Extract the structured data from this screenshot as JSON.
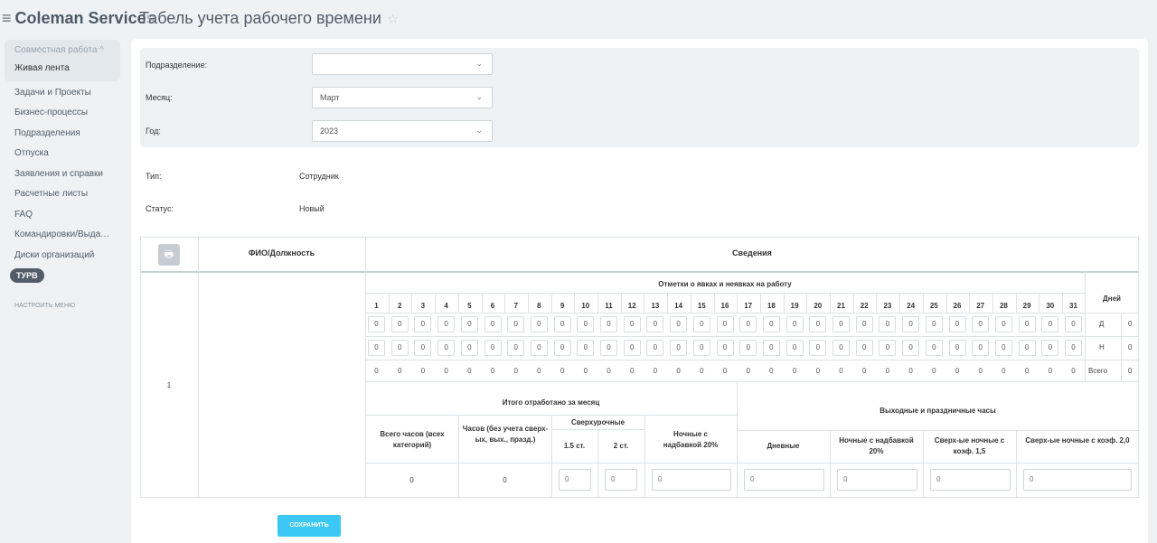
{
  "app": {
    "title_main": "Coleman Service",
    "title_cut": "s",
    "menu_glyph": "≡"
  },
  "page": {
    "title": "Табель учета рабочего времени",
    "star": "☆"
  },
  "sidebar": {
    "group_title": "Совместная работа ^",
    "items": [
      {
        "label": "Живая лента"
      },
      {
        "label": "Задачи и Проекты"
      },
      {
        "label": "Бизнес-процессы"
      },
      {
        "label": "Подразделения"
      },
      {
        "label": "Отпуска"
      },
      {
        "label": "Заявления и справки"
      },
      {
        "label": "Расчетные листы"
      },
      {
        "label": "FAQ"
      },
      {
        "label": "Командировки/Выдача п..."
      },
      {
        "label": "Диски организаций"
      }
    ],
    "badge": "ТУРВ",
    "configure": "НАСТРОИТЬ МЕНЮ"
  },
  "filters": {
    "department": {
      "label": "Подразделение:",
      "value": ""
    },
    "month": {
      "label": "Месяц:",
      "value": "Март"
    },
    "year": {
      "label": "Год:",
      "value": "2023"
    },
    "chevron": "⌄"
  },
  "info": {
    "type": {
      "label": "Тип:",
      "value": "Сотрудник"
    },
    "status": {
      "label": "Статус:",
      "value": "Новый"
    }
  },
  "table": {
    "col_name_header": "ФИО/Должность",
    "col_info_header": "Сведения",
    "attendance_header": "Отметки о явках и неявках на работу",
    "days_header": "Дней",
    "row_number": "1",
    "days": [
      "1",
      "2",
      "3",
      "4",
      "5",
      "6",
      "7",
      "8",
      "9",
      "10",
      "11",
      "12",
      "13",
      "14",
      "15",
      "16",
      "17",
      "18",
      "19",
      "20",
      "21",
      "22",
      "23",
      "24",
      "25",
      "26",
      "27",
      "28",
      "29",
      "30",
      "31"
    ],
    "day_cell_value": "0",
    "day_rows": [
      {
        "label": "Д",
        "total": "0"
      },
      {
        "label": "Н",
        "total": "0"
      },
      {
        "label": "Всего",
        "total": "0"
      }
    ],
    "month_total_header": "Итого отработано за месяц",
    "holidays_header": "Выходные и праздничные часы",
    "total_hours_header": "Всего часов (всех категорий)",
    "hours_no_extra_header": "Часов (без учета сверх-ых, вых., празд.)",
    "overtime_header": "Сверхурочные",
    "overtime_15": "1.5 ст.",
    "overtime_2": "2 ст.",
    "night_header": "Ночные с надбавкой 20%",
    "day_header": "Дневные",
    "night2_header": "Ночные с надбавкой 20%",
    "over_night_15_header": "Сверх-ые ночные с коэф. 1,5",
    "over_night_2_header": "Сверх-ые ночные с коэф. 2,0",
    "total_hours_value": "0",
    "hours_no_extra_value": "0",
    "input_values": {
      "ot15": "0",
      "ot2": "0",
      "night": "0",
      "hday": "0",
      "hnight": "0",
      "hon15": "0",
      "hon2": "0"
    }
  },
  "buttons": {
    "save": "СОХРАНИТЬ",
    "print_icon": "🖶"
  }
}
